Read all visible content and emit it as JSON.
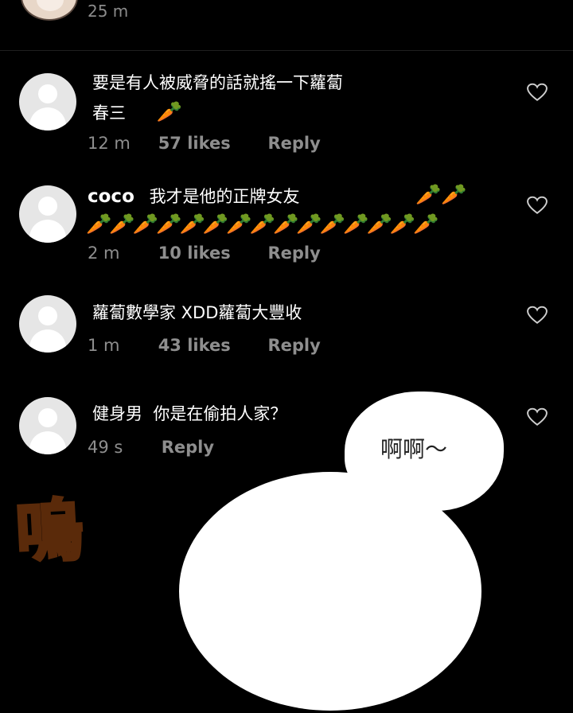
{
  "top": {
    "time": "25 m"
  },
  "comments": [
    {
      "username": "",
      "text_line1": "要是有人被威脅的話就搖一下蘿蔔",
      "text_line2": "春三",
      "carrots": "🥕",
      "time": "12 m",
      "likes": "57 likes",
      "reply": "Reply"
    },
    {
      "username": "coco",
      "text_line1": "我才是他的正牌女友",
      "carrots_inline": "🥕🥕",
      "carrots_row": "🥕🥕🥕🥕🥕🥕🥕🥕🥕🥕🥕🥕🥕🥕🥕",
      "time": "2 m",
      "likes": "10 likes",
      "reply": "Reply"
    },
    {
      "text_line1": "蘿蔔數學家 XDD蘿蔔大豐收",
      "time": "1 m",
      "likes": "43 likes",
      "reply": "Reply"
    },
    {
      "text_line1": "健身男  你是在偷拍人家？",
      "time": "49 s",
      "reply": "Reply"
    }
  ],
  "bubble": {
    "text": "啊啊～"
  },
  "sfx": "嗚",
  "icons": {
    "heart": "heart-outline-icon",
    "avatar": "default-avatar-icon"
  },
  "colors": {
    "background": "#000000",
    "meta": "#8e8e8e",
    "sfx": "#f7a51c"
  }
}
